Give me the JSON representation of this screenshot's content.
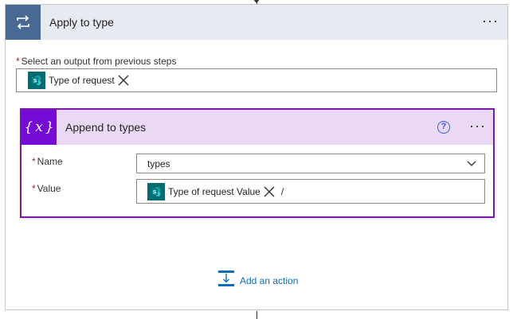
{
  "outer_card": {
    "title": "Apply to type",
    "more_label": "···",
    "select_output": {
      "label": "Select an output from previous steps",
      "required_marker": "*",
      "token_label": "Type of request"
    }
  },
  "inner_card": {
    "title": "Append to types",
    "help_label": "?",
    "more_label": "···",
    "name_field": {
      "label": "Name",
      "required_marker": "*",
      "value": "types"
    },
    "value_field": {
      "label": "Value",
      "required_marker": "*",
      "token_label": "Type of request Value",
      "trailing_text": "/"
    }
  },
  "add_action": {
    "label": "Add an action"
  },
  "colors": {
    "loop_header_icon_bg": "#486991",
    "variable_icon_bg": "#770bd6",
    "inner_card_border": "#7719aa",
    "sharepoint_token_bg": "#036c70",
    "link_blue": "#0f6cbd"
  },
  "icons": {
    "loop": "loop-icon",
    "variable": "variable-icon",
    "sharepoint": "sharepoint-icon",
    "remove": "close-icon",
    "chevron": "chevron-down-icon",
    "add_action": "add-action-icon"
  }
}
